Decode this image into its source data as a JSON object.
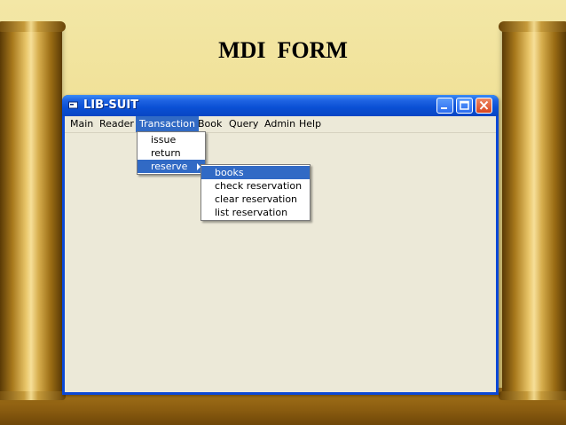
{
  "slide": {
    "title_word1": "MDI",
    "title_word2": "FORM"
  },
  "window": {
    "title": "LIB-SUIT",
    "controls": [
      "minimize",
      "maximize",
      "close"
    ]
  },
  "menubar": {
    "items": [
      {
        "label": "Main"
      },
      {
        "label": "Reader"
      },
      {
        "label": "Transaction"
      },
      {
        "label": "Book"
      },
      {
        "label": "Query"
      },
      {
        "label": "Admin"
      },
      {
        "label": "Help"
      }
    ],
    "active": "Transaction"
  },
  "transaction_menu": {
    "items": [
      {
        "label": "issue"
      },
      {
        "label": "return"
      },
      {
        "label": "reserve",
        "has_submenu": true,
        "highlighted": true
      }
    ]
  },
  "reserve_submenu": {
    "items": [
      {
        "label": "books",
        "highlighted": true
      },
      {
        "label": "check reservation"
      },
      {
        "label": "clear reservation"
      },
      {
        "label": "list reservation"
      }
    ]
  },
  "colors": {
    "highlight": "#316ac5",
    "client_bg": "#ece9d8",
    "titlebar": "#0a4fd4",
    "slide_bg": "#eedc8c"
  }
}
